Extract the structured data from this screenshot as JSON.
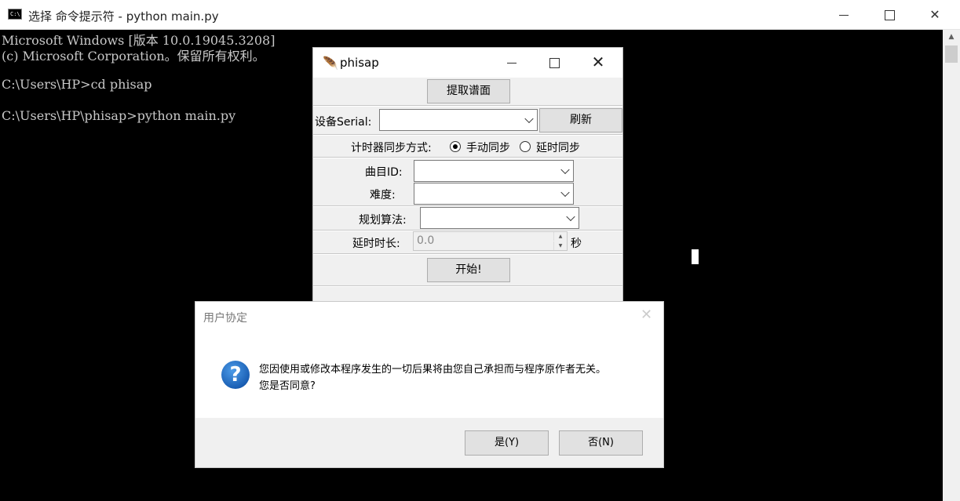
{
  "console": {
    "title": "选择 命令提示符 - python  main.py",
    "icon_label": "C:\\",
    "lines": [
      "Microsoft Windows [版本 10.0.19045.3208]",
      "(c) Microsoft Corporation。保留所有权利。",
      "",
      "C:\\Users\\HP>cd phisap",
      "",
      "C:\\Users\\HP\\phisap>python main.py"
    ]
  },
  "phisap": {
    "title": "phisap",
    "extract_button": "提取谱面",
    "device_serial_label": "设备Serial:",
    "device_serial_value": "",
    "refresh_button": "刷新",
    "sync_label": "计时器同步方式:",
    "sync_options": [
      "手动同步",
      "延时同步"
    ],
    "sync_selected": "手动同步",
    "song_id_label": "曲目ID:",
    "song_id_value": "",
    "difficulty_label": "难度:",
    "difficulty_value": "",
    "algorithm_label": "规划算法:",
    "algorithm_value": "",
    "delay_label": "延时时长:",
    "delay_value": "0.0",
    "delay_unit": "秒",
    "start_button": "开始!"
  },
  "dialog": {
    "title": "用户协定",
    "message_line1": "您因使用或修改本程序发生的一切后果将由您自己承担而与程序原作者无关。",
    "message_line2": "您是否同意?",
    "yes_button": "是(Y)",
    "no_button": "否(N)",
    "icon": "question-icon"
  }
}
